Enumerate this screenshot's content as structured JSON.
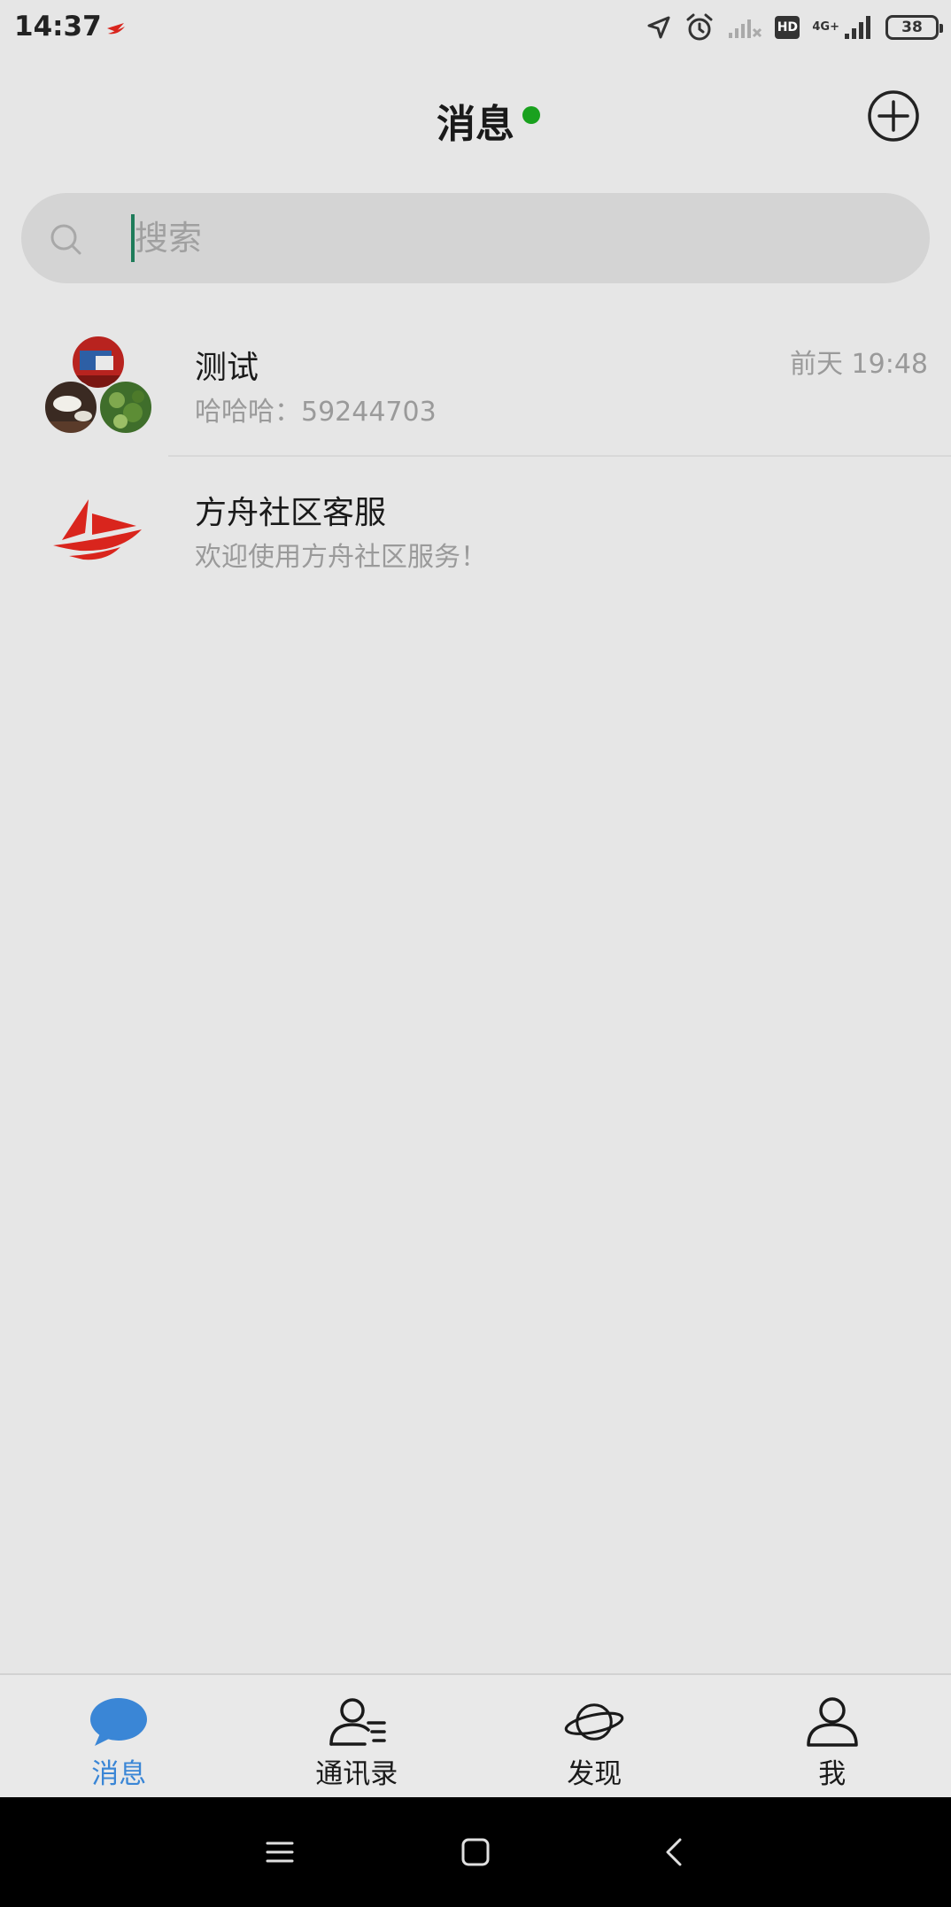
{
  "status_bar": {
    "time": "14:37",
    "network_label": "4G+",
    "hd_label": "HD",
    "battery_level": "38",
    "icons": [
      "location-icon",
      "alarm-icon",
      "wifi-off-icon",
      "hd-icon",
      "signal-icon",
      "battery-icon"
    ]
  },
  "header": {
    "title": "消息",
    "online_indicator_color": "#19a11e",
    "add_icon": "plus-circle-icon"
  },
  "search": {
    "placeholder": "搜索",
    "value": ""
  },
  "chats": [
    {
      "name": "测试",
      "preview": "哈哈哈：59244703",
      "time": "前天 19:48",
      "avatar": "group-avatar"
    },
    {
      "name": "方舟社区客服",
      "preview": "欢迎使用方舟社区服务！",
      "time": "",
      "avatar": "ark-logo-avatar"
    }
  ],
  "tabs": [
    {
      "label": "消息",
      "icon": "chat-bubble-icon",
      "active": true
    },
    {
      "label": "通讯录",
      "icon": "contacts-icon",
      "active": false
    },
    {
      "label": "发现",
      "icon": "planet-icon",
      "active": false
    },
    {
      "label": "我",
      "icon": "profile-icon",
      "active": false
    }
  ],
  "colors": {
    "accent": "#3a86d6",
    "online": "#19a11e",
    "background": "#e6e6e6",
    "brand_red": "#d9251d"
  }
}
